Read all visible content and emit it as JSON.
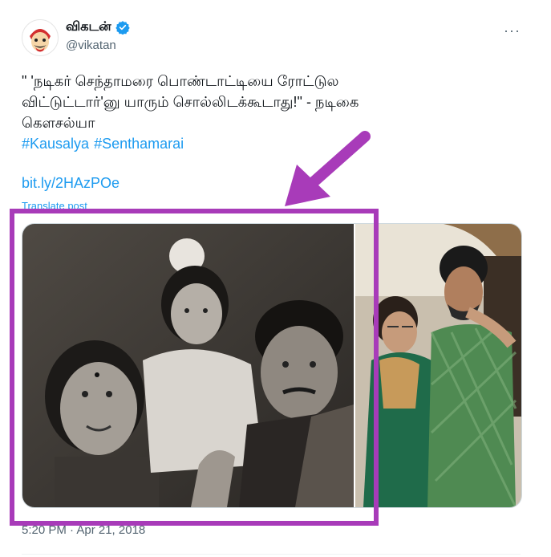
{
  "author": {
    "name": "விகடன்",
    "handle": "@vikatan",
    "verified": true,
    "avatar_icon": "vikatan-logo-icon"
  },
  "more_label": "···",
  "tweet": {
    "lines": [
      "\" 'நடிகர் செந்தாமரை பொண்டாட்டியை ரோட்டுல",
      "விட்டுட்டார்'னு யாரும் சொல்லிடக்கூடாது!\" - நடிகை",
      "கௌசல்யா"
    ],
    "hashtags": [
      "#Kausalya",
      "#Senthamarai"
    ],
    "link": "bit.ly/2HAzPOe",
    "translate": "Translate post"
  },
  "timestamp": "5:20 PM · Apr 21, 2018",
  "colors": {
    "link": "#1d9bf0",
    "highlight": "#a83bb9",
    "verified": "#1d9bf0"
  },
  "media": [
    {
      "name": "old-family-photo",
      "style": "black-and-white"
    },
    {
      "name": "mother-and-son-photo",
      "style": "color"
    }
  ]
}
